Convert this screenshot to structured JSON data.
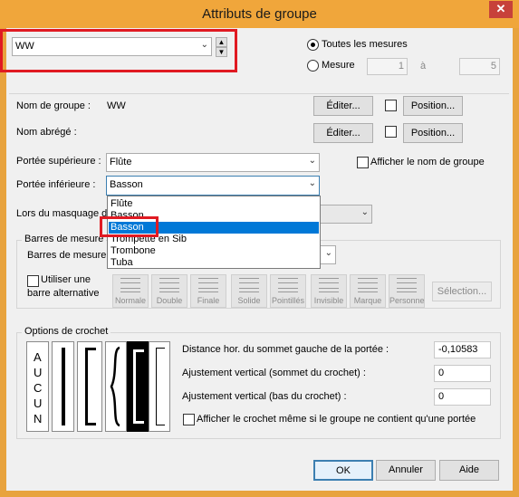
{
  "title": "Attributs de groupe",
  "close_glyph": "✕",
  "group_combo": {
    "value": "WW"
  },
  "measures": {
    "all_label": "Toutes les mesures",
    "range_label": "Mesure",
    "from": "1",
    "to_label": "à",
    "to": "5"
  },
  "group_name": {
    "label": "Nom de groupe :",
    "value": "WW",
    "edit_label": "Éditer...",
    "position_label": "Position..."
  },
  "short_name": {
    "label": "Nom abrégé :",
    "edit_label": "Éditer...",
    "position_label": "Position..."
  },
  "top_staff": {
    "label": "Portée supérieure :",
    "value": "Flûte"
  },
  "show_group_name_label": "Afficher le nom de groupe",
  "bottom_staff": {
    "label": "Portée inférieure :",
    "value": "Basson",
    "options": [
      "Flûte",
      "Basson",
      "Basson",
      "Trompette en Sib",
      "Trombone",
      "Tuba"
    ],
    "selected_index": 2
  },
  "masking_label": "Lors du masquage de",
  "barlines": {
    "group_label": "Barres de mesure",
    "barlines_label": "Barres de mesure :",
    "alt_label_1": "Utiliser une",
    "alt_label_2": "barre alternative",
    "buttons": [
      "Normale",
      "Double",
      "Finale",
      "Solide",
      "Pointillés",
      "Invisible",
      "Marque",
      "Personne"
    ],
    "selection_label": "Sélection..."
  },
  "brackets": {
    "group_label": "Options de crochet",
    "letters": [
      "A",
      "U",
      "C",
      "U",
      "N"
    ],
    "distance_label": "Distance hor. du sommet gauche de la portée :",
    "distance_value": "-0,10583",
    "top_adjust_label": "Ajustement vertical (sommet du crochet) :",
    "top_adjust_value": "0",
    "bottom_adjust_label": "Ajustement vertical (bas du crochet) :",
    "bottom_adjust_value": "0",
    "single_staff_label": "Afficher le crochet même si le groupe ne contient qu'une portée"
  },
  "footer": {
    "ok": "OK",
    "cancel": "Annuler",
    "help": "Aide"
  },
  "colors": {
    "accent": "#0078d7",
    "highlight": "#e01a22",
    "titlebar": "#f0a63b"
  }
}
